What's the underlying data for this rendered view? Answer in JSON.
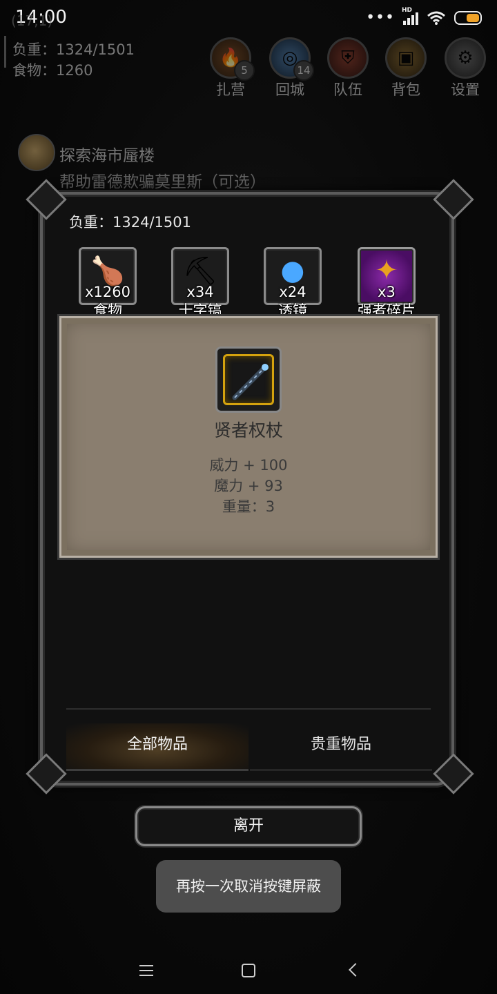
{
  "status_bar": {
    "time": "14:00",
    "network": "HD"
  },
  "hud": {
    "coord": "(17,1)",
    "weight": "负重：1324/1501",
    "food": "食物：1260",
    "buttons": [
      {
        "label": "扎营",
        "badge": "5",
        "icon": "campfire-icon"
      },
      {
        "label": "回城",
        "badge": "14",
        "icon": "portal-icon"
      },
      {
        "label": "队伍",
        "badge": "",
        "icon": "shield-icon"
      },
      {
        "label": "背包",
        "badge": "",
        "icon": "backpack-icon"
      },
      {
        "label": "设置",
        "badge": "",
        "icon": "gear-icon"
      }
    ]
  },
  "quest": {
    "title": "探索海市蜃楼",
    "subtitle": "帮助雷德欺骗莫里斯（可选）"
  },
  "dialog": {
    "weight": "负重：1324/1501",
    "resources": [
      {
        "name": "食物",
        "qty": "x1260",
        "icon": "meat-icon"
      },
      {
        "name": "十字镐",
        "qty": "x34",
        "icon": "pickaxe-icon"
      },
      {
        "name": "透镜",
        "qty": "x24",
        "icon": "lens-icon"
      },
      {
        "name": "强者碎片",
        "qty": "x3",
        "icon": "shard-icon"
      }
    ],
    "item": {
      "name": "贤者权杖",
      "icon": "scepter-icon",
      "stats": [
        "威力 + 100",
        "魔力 + 93",
        "重量：3"
      ]
    },
    "tabs": {
      "all": "全部物品",
      "valuable": "贵重物品"
    }
  },
  "leave_button": "离开",
  "toast": "再按一次取消按键屏蔽",
  "colors": {
    "rarity_gold": "#d4a20e",
    "shard_purple": "#8a2aa8",
    "battery": "#f0a329"
  }
}
